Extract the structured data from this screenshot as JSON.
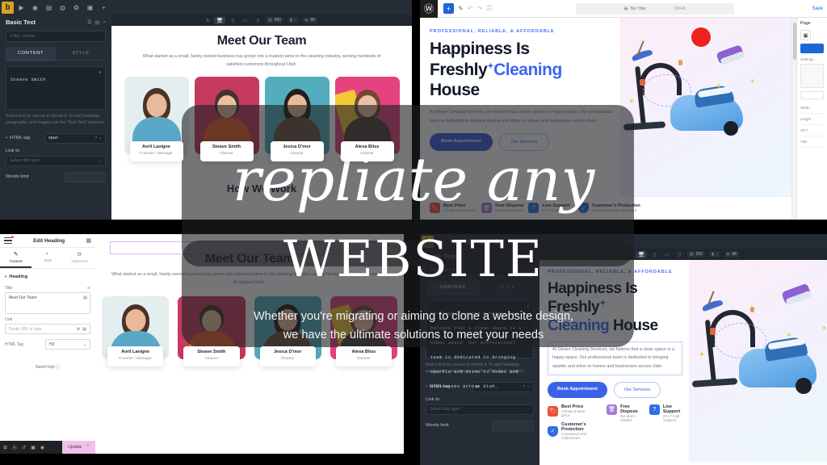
{
  "overlay": {
    "headline_line1": "repliate any",
    "headline_line2": "WEBSITE",
    "sub_line1": "Whether you're migrating or aiming to clone a website design,",
    "sub_line2": "we have the ultimate solutions to meet your needs"
  },
  "bricks_top": {
    "logo": "b",
    "toolbar_icons": [
      "play-icon",
      "info-icon",
      "structure-icon",
      "settings-icon",
      "gear-icon",
      "save-icon",
      "plus-icon"
    ],
    "panel_title": "Basic Text",
    "panel_tool_icons": [
      "copy-icon",
      "paste-icon",
      "search-icon"
    ],
    "search_placeholder": "Filter control",
    "tabs": [
      {
        "label": "CONTENT",
        "active": true
      },
      {
        "label": "STYLE",
        "active": false
      }
    ],
    "text_value": "Steave Smith",
    "hint": "Select text on canvas to format it. To add headings, paragraphs, and images use the \"Rich Text\" element.",
    "html_tag_label": "HTML tag",
    "html_tag_value": "span",
    "link_to_label": "Link to",
    "link_to_value": "Select link type",
    "words_limit_label": "Words limit",
    "words_limit_value": "",
    "canvas_bar": {
      "refresh": "refresh-icon",
      "devices": [
        "desktop-icon",
        "tablet-portrait-icon",
        "tablet-landscape-icon",
        "mobile-icon"
      ],
      "width_value": "992",
      "zoom_value": "100",
      "grid_value": "88"
    }
  },
  "bricks_bottom": {
    "logo": "b",
    "panel_title": "Basic Text",
    "search_placeholder": "Filter control",
    "tabs": [
      {
        "label": "CONTENT",
        "active": true
      },
      {
        "label": "STYLE",
        "active": false
      }
    ],
    "text_value": "At Gleam Cleaning Services, we believe that a clean space is a happy space. Our professional team is dedicated to bringing sparkle and shine to homes and businesses across Utah.",
    "hint": "Select text on canvas to format it. To add headings, paragraphs, and images use the \"Rich Text\" element.",
    "html_tag_label": "HTML tag",
    "html_tag_value": "p",
    "link_to_label": "Link to",
    "link_to_value": "Select link type",
    "words_limit_label": "Words limit",
    "words_limit_value": "",
    "canvas_bar": {
      "width_value": "992",
      "zoom_value": "100",
      "grid_value": "88"
    }
  },
  "wordpress": {
    "logo": "wordpress-icon",
    "tool_icons": [
      "add-block-icon",
      "edit-pen-icon",
      "undo-icon",
      "redo-icon",
      "document-overview-icon"
    ],
    "command_bar": {
      "doc_icon": "page-icon",
      "title": "No Title",
      "shortcut": "Ctrl+K"
    },
    "save_label": "Save",
    "sidebar": {
      "title": "Page",
      "icon": "featured-image-icon",
      "settings_label": "Settings",
      "rows": [
        "Width",
        "Height",
        "Alt T",
        "Title"
      ]
    }
  },
  "elementor": {
    "panel_title": "Edit Heading",
    "menu_icon": "hamburger-icon",
    "grid_icon": "widgets-grid-icon",
    "tabs": [
      {
        "label": "Content",
        "icon": "pencil-icon",
        "active": true
      },
      {
        "label": "Style",
        "icon": "brush-icon",
        "active": false
      },
      {
        "label": "Advanced",
        "icon": "gear-icon",
        "active": false
      }
    ],
    "section_label": "Heading",
    "title_label": "Title",
    "title_value": "Meet Our Team",
    "link_label": "Link",
    "link_placeholder": "Paste URL or type",
    "html_tag_label": "HTML Tag",
    "html_tag_value": "H2",
    "need_help_label": "Need Help",
    "footer_icons": [
      "settings-icon",
      "navigator-icon",
      "history-icon",
      "responsive-icon",
      "preview-icon"
    ],
    "update_label": "Update"
  },
  "team_section": {
    "heading": "Meet Our Team",
    "description": "What started as a small, family-owned business has grown into a trusted name in the cleaning industry, serving hundreds of satisfied customers throughout Utah.",
    "next_heading": "How We Work",
    "members": [
      {
        "name": "Avril Lavigne",
        "role": "Founder / Manager",
        "role_bl": "Founder / Manager",
        "bg": "#e4eeee",
        "shirt": "#5aa8c7",
        "hair": "#4b3226",
        "skin": "#e8b99a"
      },
      {
        "name": "Steave Smith",
        "role": "Cleaner",
        "role_bl": "Cleaner",
        "bg": "#c53a5e",
        "shirt": "#e2632c",
        "hair": "#43332a",
        "skin": "#edbf9c"
      },
      {
        "name": "Jesica D'mor",
        "role": "Cleaner",
        "role_bl": "Cleaner",
        "bg": "#53adbd",
        "shirt": "#6d5243",
        "hair": "#241c1a",
        "skin": "#e9bb99"
      },
      {
        "name": "Alexa Bliss",
        "role": "Cleaner",
        "role_bl": "Cleaner",
        "bg": "#e5427f",
        "shirt": "#4e4039",
        "hair": "#6e4a32",
        "skin": "#eec0a2"
      }
    ]
  },
  "hero_section": {
    "eyebrow": "PROFESSIONAL, RELIABLE, & AFFORDABLE",
    "title_part1": "Happiness Is Freshly",
    "title_blue": "Cleaning",
    "title_part2": "House",
    "paragraph": "At Gleam Cleaning Services, we believe that a clean space is a happy space. Our professional team is dedicated to bringing sparkle and shine to homes and businesses across Utah.",
    "btn_primary": "Book Appointment",
    "btn_secondary": "Our Services",
    "features": [
      {
        "title": "Best Price",
        "sub": "Cheap & Best price",
        "icon": "price-tag-icon",
        "color": "#e8503a"
      },
      {
        "title": "Free Dispose",
        "sub": "No More Clutter",
        "icon": "trash-cart-icon",
        "color": "#a87ae0"
      },
      {
        "title": "Live Support",
        "sub": "24×7 Call Support",
        "icon": "headset-icon",
        "color": "#2f6fe4"
      },
      {
        "title": "Customer's Protection",
        "sub": "Licensend and Authorized",
        "icon": "shield-check-icon",
        "color": "#2f6fe4"
      }
    ],
    "illustration": "vacuum-cleaner-illustration"
  },
  "colors": {
    "brand_blue": "#3b5bdb",
    "accent_blue": "#4a6cf7",
    "bricks_yellow": "#d5a429",
    "elementor_pink": "#f1c0e8",
    "overlay_veil": "rgba(30,32,36,0.62)"
  }
}
